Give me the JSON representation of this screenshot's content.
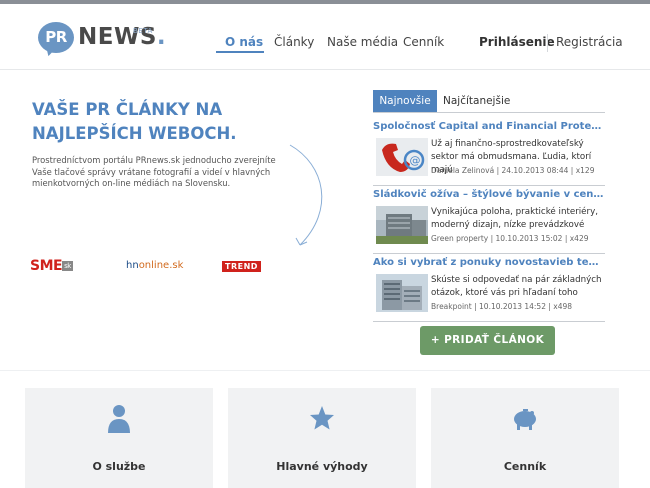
{
  "brand": {
    "pr": "PR",
    "news": "NEWS",
    "dot": ".",
    "beta": "BETA"
  },
  "nav": {
    "items": [
      {
        "label": "O nás",
        "active": true
      },
      {
        "label": "Články"
      },
      {
        "label": "Naše média"
      },
      {
        "label": "Cenník"
      }
    ],
    "login": "Prihlásenie",
    "register": "Registrácia"
  },
  "hero": {
    "title": "VAŠE PR ČLÁNKY NA NAJLEPŠÍCH WEBOCH.",
    "description": "Prostredníctvom portálu PRnews.sk jednoducho zverejníte Vaše tlačové správy vrátane fotografií a videí v hlavných mienkotvorných on-line médiách na Slovensku."
  },
  "partners": {
    "sme": "SME",
    "sme_sk": "sk",
    "hn_hn": "hn",
    "hn_online": "online.sk",
    "trend": "TREND"
  },
  "tabs": [
    {
      "label": "Najnovšie",
      "active": true
    },
    {
      "label": "Najčítanejšie"
    }
  ],
  "articles": [
    {
      "title": "Spoločnosť Capital and Financial Protectio...",
      "text": "Už aj finančno-sprostredkovateľský sektor má obmudsmana. Ľudia, ktorí majú",
      "meta": "Daniela Zelinová | 24.10.2013 08:44 | x129"
    },
    {
      "title": "Sládkovič ožíva – štýlové bývanie v centre...",
      "text": "Vynikajúca poloha, praktické interiéry, moderný dizajn, nízke prevádzkové",
      "meta": "Green property | 10.10.2013 15:02 | x429"
    },
    {
      "title": "Ako si vybrať z ponuky novostavieb ten spr...",
      "text": "Skúste si odpovedať na pár základných otázok, ktoré vás pri hľadaní toho",
      "meta": "Breakpoint | 10.10.2013 14:52 | x498"
    }
  ],
  "add_button": "+ PRIDAŤ ČLÁNOK",
  "cards": [
    {
      "label": "O službe",
      "icon": "person-icon"
    },
    {
      "label": "Hlavné výhody",
      "icon": "star-icon"
    },
    {
      "label": "Cenník",
      "icon": "piggy-bank-icon"
    }
  ],
  "colors": {
    "accent": "#4f83be",
    "button_green": "#6d9a67",
    "card_bg": "#f1f2f3"
  }
}
